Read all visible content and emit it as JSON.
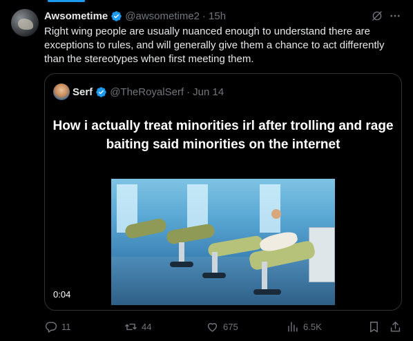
{
  "tweet": {
    "author_name": "Awsometime",
    "handle": "@awsometime2",
    "separator": "·",
    "time": "15h",
    "text": "Right wing people are usually nuanced enough to understand there are exceptions to rules, and will generally give them a chance to act differently than the stereotypes when first meeting them."
  },
  "quote": {
    "author_name": "Serf",
    "handle": "@TheRoyalSerf",
    "separator": "·",
    "date": "Jun 14",
    "video_caption": "How i actually treat minorities irl after trolling and rage baiting said minorities on the internet",
    "duration": "0:04"
  },
  "actions": {
    "replies": "11",
    "reposts": "44",
    "likes": "675",
    "views": "6.5K"
  },
  "colors": {
    "accent": "#1d9bf0",
    "text": "#e7e9ea",
    "muted": "#71767b",
    "border": "#2f3336"
  },
  "icons": [
    "verified-badge-icon",
    "grok-icon",
    "more-icon",
    "reply-icon",
    "repost-icon",
    "like-icon",
    "views-icon",
    "bookmark-icon",
    "share-icon"
  ]
}
